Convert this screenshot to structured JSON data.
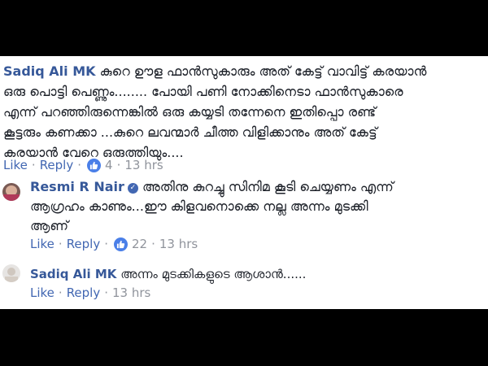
{
  "comments": [
    {
      "author": "Sadiq Ali MK",
      "lines": [
        "കുറെ ഊള ഫാൻസുകാരും അത് കേട്ട് വാവിട്ട് കരയാൻ",
        "ഒരു പൊട്ടി പെണ്ണും........ പോയി പണി നോക്കിനെടാ ഫാൻസുകാരെ",
        "എന്ന് പറഞ്ഞിരുന്നെങ്കിൽ ഒരു കയ്യടി തന്നേനെ ഇതിപ്പൊ രണ്ട്",
        "കൂട്ടരും കണക്കാ ...കുറെ ലവന്മാർ ചീത്ത വിളിക്കാനും അത് കേട്ട്",
        "കരയാൻ വേറെ ഒരുത്തിയും...."
      ],
      "like_label": "Like",
      "reply_label": "Reply",
      "reaction_count": "4",
      "time": "13 hrs"
    },
    {
      "author": "Resmi R Nair",
      "lines": [
        "അതിനു കുറച്ചു സിനിമ കൂടി ചെയ്യണം എന്ന്",
        "ആഗ്രഹം കാണും...ഈ കിളവനൊക്കെ നല്ല അന്നം മുടക്കി",
        "ആണ്"
      ],
      "like_label": "Like",
      "reply_label": "Reply",
      "reaction_count": "22",
      "time": "13 hrs"
    },
    {
      "author": "Sadiq Ali MK",
      "lines": [
        "അന്നം മുടക്കികളുടെ ആശാൻ......"
      ],
      "like_label": "Like",
      "reply_label": "Reply",
      "time": "13 hrs"
    }
  ],
  "icons": [
    "thumbs-up-icon",
    "verified-badge-icon",
    "avatar"
  ],
  "colors": {
    "author": "#365899",
    "link": "#4267b2",
    "meta": "#90949c",
    "text": "#1d2129",
    "reaction_badge": "#4a7fe8"
  }
}
